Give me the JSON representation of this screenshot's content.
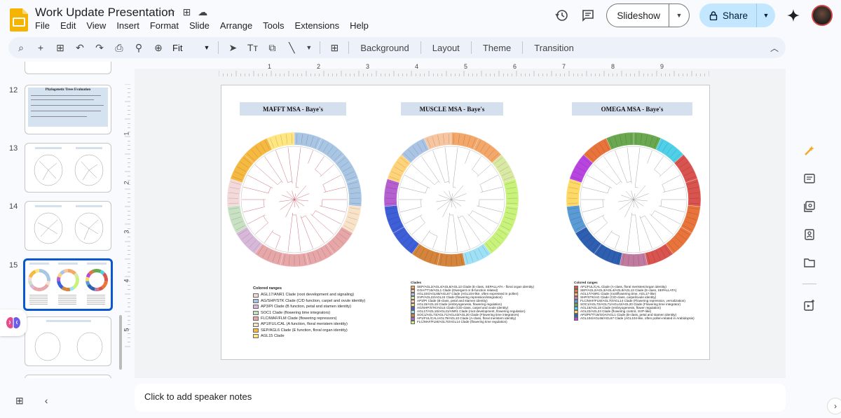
{
  "doc": {
    "title": "Work Update Presentation"
  },
  "menu": [
    "File",
    "Edit",
    "View",
    "Insert",
    "Format",
    "Slide",
    "Arrange",
    "Tools",
    "Extensions",
    "Help"
  ],
  "actions": {
    "slideshow": "Slideshow",
    "share": "Share"
  },
  "toolbar": {
    "zoom": "Fit",
    "background": "Background",
    "layout": "Layout",
    "theme": "Theme",
    "transition": "Transition"
  },
  "ruler": {
    "marks": [
      "1",
      "2",
      "3",
      "4",
      "5",
      "6",
      "7",
      "8",
      "9"
    ],
    "vmarks": [
      "1",
      "2",
      "3",
      "4",
      "5"
    ]
  },
  "filmstrip": {
    "slides": [
      {
        "num": "12",
        "title": "Phylogenetic Trees Evaluation"
      },
      {
        "num": "13"
      },
      {
        "num": "14"
      },
      {
        "num": "15",
        "selected": true
      },
      {
        "num": ""
      }
    ]
  },
  "slide": {
    "panels": [
      {
        "title": "MAFFT MSA - Baye's",
        "legend_title": "Colored ranges",
        "legend": [
          {
            "label": "AGL17/ANR1 Clade (root development and signaling)",
            "color": "#f3d9d9"
          },
          {
            "label": "AG/SHP/STK Clade (C/D function, carpel and ovule identity)",
            "color": "#a8c6e3"
          },
          {
            "label": "AP3/PI Clade (B function, petal and stamen identity)",
            "color": "#d7b8d8"
          },
          {
            "label": "SOC1 Clade (flowering time integrators)",
            "color": "#c9e1c3"
          },
          {
            "label": "FLC/MAF/FLM Clade (flowering repressors)",
            "color": "#e7a7a8"
          },
          {
            "label": "AP1/FUL/CAL (A function, floral meristem identity)",
            "color": "#f9e3c8"
          },
          {
            "label": "SEP/AGL6 Clade (E function, floral organ identity)",
            "color": "#f5b942"
          },
          {
            "label": "AGL15 Clade",
            "color": "#ffe680"
          }
        ],
        "ring": [
          "#a8c6e3",
          "#a8c6e3",
          "#a8c6e3",
          "#a8c6e3",
          "#f9e3c8",
          "#e7a7a8",
          "#e7a7a8",
          "#e7a7a8",
          "#e7a7a8",
          "#d7b8d8",
          "#c9e1c3",
          "#f3d9d9",
          "#f5b942",
          "#f5b942",
          "#ffe680"
        ]
      },
      {
        "title": "MUSCLE MSA - Baye's",
        "legend_title": "Clades",
        "legend": [
          {
            "label": "SEP/AGL2/AGL4/AGL6/AGL13 Clade (E-class, SEPALLATA - floral organ identity)",
            "color": "#f3a86a"
          },
          {
            "label": "GOA/TT16/AGL1 Clade (Divergent or B-function related)",
            "color": "#f7c6a0"
          },
          {
            "label": "AGL104/AGL66/AGL67 Clade (AGL104-like, often expressed in pollen)",
            "color": "#a9c4e5"
          },
          {
            "label": "SVP/AGL22/AGL24 Clade (flowering repression/integration)",
            "color": "#d9e8a3"
          },
          {
            "label": "AP3/PI Clade (B-class, petal and stamen identity)",
            "color": "#f7d2a8"
          },
          {
            "label": "AGL15/AGL18 Clade (embryogenesis, flowering regulation)",
            "color": "#ffd37a"
          },
          {
            "label": "AG/SHP/STK/AGL5 Clade (C/D-class, carpel and ovule identity)",
            "color": "#3f5fd8"
          },
          {
            "label": "AGL17/AGL16/AGL21/ANR1 Clade (root development, flowering regulation)",
            "color": "#9ee0f5"
          },
          {
            "label": "SOC1/AGL73/AGL71/AGL43/AGL20 Clade (Flowering time integrators)",
            "color": "#d4843b"
          },
          {
            "label": "AP1/FUL/CAL/AGL79/AGL10 Clade (A-class, floral meristem identity)",
            "color": "#b65fd1"
          },
          {
            "label": "FLC/MAF/FLM/AGL70/AGL14 Clade (flowering time regulation)",
            "color": "#c8f27a"
          }
        ],
        "ring": [
          "#f3a86a",
          "#f3a86a",
          "#d9e8a3",
          "#c8f27a",
          "#c8f27a",
          "#c8f27a",
          "#9ee0f5",
          "#d4843b",
          "#d4843b",
          "#3f5fd8",
          "#3f5fd8",
          "#b65fd1",
          "#ffd37a",
          "#a9c4e5",
          "#f7c6a0"
        ]
      },
      {
        "title": "OMEGA MSA - Baye's",
        "legend_title": "Colored ranges",
        "legend": [
          {
            "label": "AP1/FUL/CAL Clade (A-class, floral meristem/organ identity)",
            "color": "#d9534f"
          },
          {
            "label": "SEP/AGL2/AGL3/AGL4/AGL9/AGL13 Clade (E-class, SEPALLATA)",
            "color": "#e8743b"
          },
          {
            "label": "AGL17/ANR1 Clade (root/flowering time, AGL17-like)",
            "color": "#f6b26b"
          },
          {
            "label": "SHP/STK/AG Clade (C/D-class, carpel/ovule identity)",
            "color": "#c27ba0"
          },
          {
            "label": "FLC/MAF/FLM/AGL70/AGL14 Clade (Flowering repression, vernalization)",
            "color": "#5b9bd5"
          },
          {
            "label": "SOC1/AGL72/AGL71/AGL42/AGL20 Clade (Flowering time integrator)",
            "color": "#6aa84f"
          },
          {
            "label": "AGL15/AGL18 Clade (embryogenesis, flower regulation)",
            "color": "#4fd0e8"
          },
          {
            "label": "AGL22/AGL24 Clade (flowering control, SVP-like)",
            "color": "#ffd966"
          },
          {
            "label": "AP3/PI/TT16/GOA/AGL1 Clade (B-class, petal and stamen identity)",
            "color": "#2e5fb0"
          },
          {
            "label": "AGL104/AGL66/AGL67 Clade (AGL104-like, often pollen-related in Arabidopsis)",
            "color": "#b845e0"
          }
        ],
        "ring": [
          "#6aa84f",
          "#4fd0e8",
          "#d9534f",
          "#d9534f",
          "#e8743b",
          "#e8743b",
          "#d9534f",
          "#c27ba0",
          "#2e5fb0",
          "#2e5fb0",
          "#5b9bd5",
          "#ffd966",
          "#b845e0",
          "#e8743b",
          "#6aa84f"
        ]
      }
    ]
  },
  "notes": {
    "placeholder": "Click to add speaker notes"
  },
  "colors": {
    "accent": "#0b57d0",
    "share_bg": "#c2e7ff",
    "toolbar_bg": "#edf2fa"
  }
}
